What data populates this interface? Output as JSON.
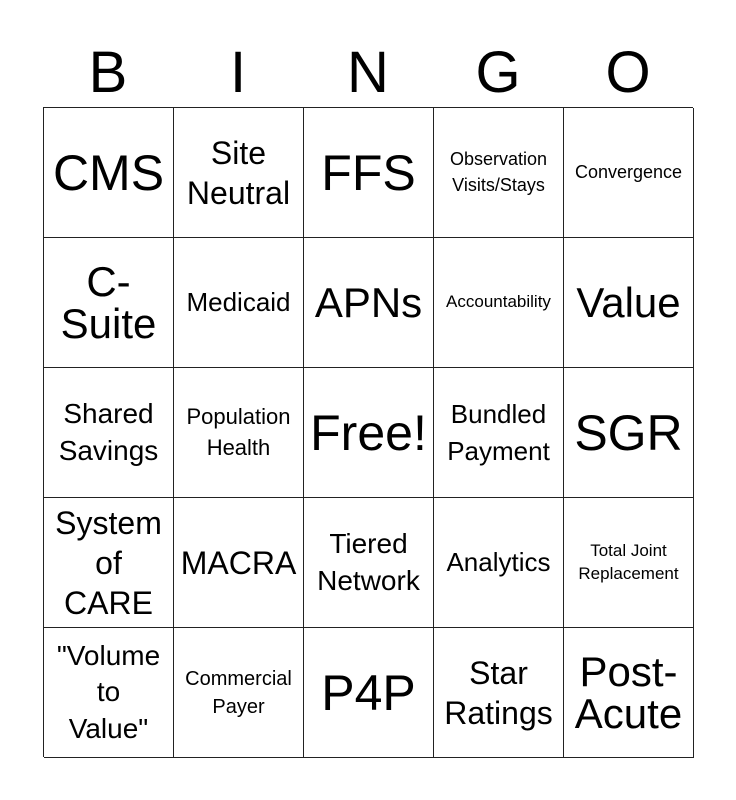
{
  "header": [
    "B",
    "I",
    "N",
    "G",
    "O"
  ],
  "cells": [
    {
      "text": "CMS",
      "size": "s50"
    },
    {
      "text": "Site\nNeutral",
      "size": "s32"
    },
    {
      "text": "FFS",
      "size": "s50"
    },
    {
      "text": "Observation\nVisits/Stays",
      "size": "s18"
    },
    {
      "text": "Convergence",
      "size": "s18"
    },
    {
      "text": "C-\nSuite",
      "size": "s42"
    },
    {
      "text": "Medicaid",
      "size": "s26"
    },
    {
      "text": "APNs",
      "size": "s42"
    },
    {
      "text": "Accountability",
      "size": "s17"
    },
    {
      "text": "Value",
      "size": "s42"
    },
    {
      "text": "Shared\nSavings",
      "size": "s28"
    },
    {
      "text": "Population\nHealth",
      "size": "s22"
    },
    {
      "text": "Free!",
      "size": "s50"
    },
    {
      "text": "Bundled\nPayment",
      "size": "s26"
    },
    {
      "text": "SGR",
      "size": "s50"
    },
    {
      "text": "System\nof\nCARE",
      "size": "s32"
    },
    {
      "text": "MACRA",
      "size": "s32"
    },
    {
      "text": "Tiered\nNetwork",
      "size": "s28"
    },
    {
      "text": "Analytics",
      "size": "s26"
    },
    {
      "text": "Total Joint\nReplacement",
      "size": "s17"
    },
    {
      "text": "\"Volume\nto\nValue\"",
      "size": "s28"
    },
    {
      "text": "Commercial\nPayer",
      "size": "s20"
    },
    {
      "text": "P4P",
      "size": "s50"
    },
    {
      "text": "Star\nRatings",
      "size": "s32"
    },
    {
      "text": "Post-\nAcute",
      "size": "s42"
    }
  ]
}
